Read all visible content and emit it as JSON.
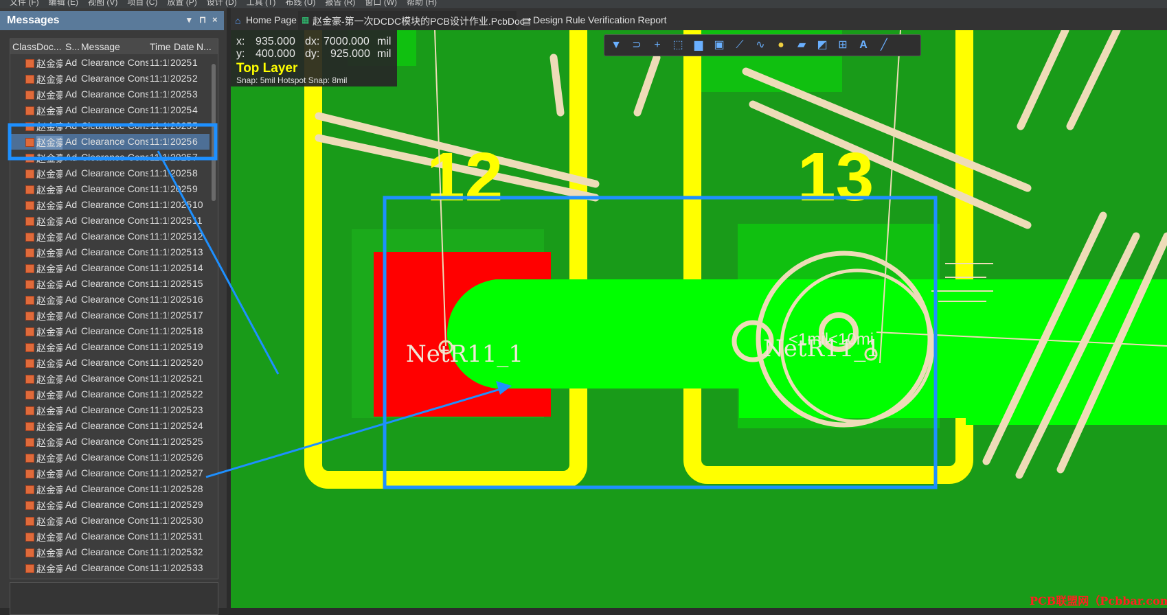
{
  "menubar": {
    "items": [
      "文件 (F)",
      "编辑 (E)",
      "视图 (V)",
      "项目 (C)",
      "放置 (P)",
      "设计 (D)",
      "工具 (T)",
      "布线 (U)",
      "报告 (R)",
      "窗口 (W)",
      "帮助 (H)"
    ]
  },
  "messages_panel": {
    "title": "Messages",
    "controls": {
      "menu": "▾",
      "pin": "⊓",
      "close": "×"
    },
    "columns": {
      "class": "Class",
      "doc": "Doc...",
      "source": "S...",
      "message": "Message",
      "time": "Time",
      "date": "Date",
      "no": "N..."
    },
    "rows": [
      {
        "doc": "赵金豪",
        "source": "Ad",
        "message": "Clearance Const",
        "time": "11:1!",
        "date": "2025",
        "no": "1"
      },
      {
        "doc": "赵金豪",
        "source": "Ad",
        "message": "Clearance Const",
        "time": "11:1!",
        "date": "2025",
        "no": "2"
      },
      {
        "doc": "赵金豪",
        "source": "Ad",
        "message": "Clearance Const",
        "time": "11:1!",
        "date": "2025",
        "no": "3"
      },
      {
        "doc": "赵金豪",
        "source": "Ad",
        "message": "Clearance Const",
        "time": "11:1!",
        "date": "2025",
        "no": "4"
      },
      {
        "doc": "赵金豪",
        "source": "Ad",
        "message": "Clearance Const",
        "time": "11:1!",
        "date": "2025",
        "no": "5"
      },
      {
        "doc": "赵金豪",
        "source": "Ad",
        "message": "Clearance Const",
        "time": "11:1!",
        "date": "2025",
        "no": "6"
      },
      {
        "doc": "赵金豪",
        "source": "Ad",
        "message": "Clearance Const",
        "time": "11:1!",
        "date": "2025",
        "no": "7"
      },
      {
        "doc": "赵金豪",
        "source": "Ad",
        "message": "Clearance Const",
        "time": "11:1!",
        "date": "2025",
        "no": "8"
      },
      {
        "doc": "赵金豪",
        "source": "Ad",
        "message": "Clearance Const",
        "time": "11:1!",
        "date": "2025",
        "no": "9"
      },
      {
        "doc": "赵金豪",
        "source": "Ad",
        "message": "Clearance Const",
        "time": "11:1!",
        "date": "2025",
        "no": "10"
      },
      {
        "doc": "赵金豪",
        "source": "Ad",
        "message": "Clearance Const",
        "time": "11:1!",
        "date": "2025",
        "no": "11"
      },
      {
        "doc": "赵金豪",
        "source": "Ad",
        "message": "Clearance Const",
        "time": "11:1!",
        "date": "2025",
        "no": "12"
      },
      {
        "doc": "赵金豪",
        "source": "Ad",
        "message": "Clearance Const",
        "time": "11:1!",
        "date": "2025",
        "no": "13"
      },
      {
        "doc": "赵金豪",
        "source": "Ad",
        "message": "Clearance Const",
        "time": "11:1!",
        "date": "2025",
        "no": "14"
      },
      {
        "doc": "赵金豪",
        "source": "Ad",
        "message": "Clearance Const",
        "time": "11:1!",
        "date": "2025",
        "no": "15"
      },
      {
        "doc": "赵金豪",
        "source": "Ad",
        "message": "Clearance Const",
        "time": "11:1!",
        "date": "2025",
        "no": "16"
      },
      {
        "doc": "赵金豪",
        "source": "Ad",
        "message": "Clearance Const",
        "time": "11:1!",
        "date": "2025",
        "no": "17"
      },
      {
        "doc": "赵金豪",
        "source": "Ad",
        "message": "Clearance Const",
        "time": "11:1!",
        "date": "2025",
        "no": "18"
      },
      {
        "doc": "赵金豪",
        "source": "Ad",
        "message": "Clearance Const",
        "time": "11:1!",
        "date": "2025",
        "no": "19"
      },
      {
        "doc": "赵金豪",
        "source": "Ad",
        "message": "Clearance Const",
        "time": "11:1!",
        "date": "2025",
        "no": "20"
      },
      {
        "doc": "赵金豪",
        "source": "Ad",
        "message": "Clearance Const",
        "time": "11:1!",
        "date": "2025",
        "no": "21"
      },
      {
        "doc": "赵金豪",
        "source": "Ad",
        "message": "Clearance Const",
        "time": "11:1!",
        "date": "2025",
        "no": "22"
      },
      {
        "doc": "赵金豪",
        "source": "Ad",
        "message": "Clearance Const",
        "time": "11:1!",
        "date": "2025",
        "no": "23"
      },
      {
        "doc": "赵金豪",
        "source": "Ad",
        "message": "Clearance Const",
        "time": "11:1!",
        "date": "2025",
        "no": "24"
      },
      {
        "doc": "赵金豪",
        "source": "Ad",
        "message": "Clearance Const",
        "time": "11:1!",
        "date": "2025",
        "no": "25"
      },
      {
        "doc": "赵金豪",
        "source": "Ad",
        "message": "Clearance Const",
        "time": "11:1!",
        "date": "2025",
        "no": "26"
      },
      {
        "doc": "赵金豪",
        "source": "Ad",
        "message": "Clearance Const",
        "time": "11:1!",
        "date": "2025",
        "no": "27"
      },
      {
        "doc": "赵金豪",
        "source": "Ad",
        "message": "Clearance Const",
        "time": "11:1!",
        "date": "2025",
        "no": "28"
      },
      {
        "doc": "赵金豪",
        "source": "Ad",
        "message": "Clearance Const",
        "time": "11:1!",
        "date": "2025",
        "no": "29"
      },
      {
        "doc": "赵金豪",
        "source": "Ad",
        "message": "Clearance Const",
        "time": "11:1!",
        "date": "2025",
        "no": "30"
      },
      {
        "doc": "赵金豪",
        "source": "Ad",
        "message": "Clearance Const",
        "time": "11:1!",
        "date": "2025",
        "no": "31"
      },
      {
        "doc": "赵金豪",
        "source": "Ad",
        "message": "Clearance Const",
        "time": "11:1!",
        "date": "2025",
        "no": "32"
      },
      {
        "doc": "赵金豪",
        "source": "Ad",
        "message": "Clearance Const",
        "time": "11:1!",
        "date": "2025",
        "no": "33"
      }
    ],
    "selected_row": "6"
  },
  "tabs": [
    {
      "icon": "home-icon",
      "label": "Home Page"
    },
    {
      "icon": "pcb-doc-icon",
      "label": "赵金豪-第一次DCDC模块的PCB设计作业.PcbDoc *"
    },
    {
      "icon": "report-icon",
      "label": "Design Rule Verification Report"
    }
  ],
  "coords": {
    "x_label": "x:",
    "x": "935.000",
    "dx_label": "dx:",
    "dx": "7000.000",
    "dx_unit": "mil",
    "y_label": "y:",
    "y": "400.000",
    "dy_label": "dy:",
    "dy": "925.000",
    "dy_unit": "mil",
    "layer": "Top Layer",
    "snap": "Snap: 5mil Hotspot Snap: 8mil"
  },
  "canvas_toolbar": {
    "tools": [
      "filter-icon",
      "route-icon",
      "add-icon",
      "select-rect-icon",
      "chart-icon",
      "component-icon",
      "interactive-route-icon",
      "diff-pair-icon",
      "pad-icon",
      "fill-icon",
      "polygon-icon",
      "dimension-icon",
      "text-icon",
      "line-icon"
    ]
  },
  "pcb": {
    "pad_labels": [
      "12",
      "13"
    ],
    "net_label_left": "NetR11_1",
    "net_label_right": "NetR11_1",
    "overlay_text": "<1mil<10mi"
  },
  "colors": {
    "board": "#199b19",
    "copper": "#00ff00",
    "outline": "#ffff00",
    "silk": "#eedcb8",
    "annotation": "#1e90ff",
    "violation_pad": "#ff0000"
  },
  "watermark": "PCB联盟网（Pcbbar.com）"
}
